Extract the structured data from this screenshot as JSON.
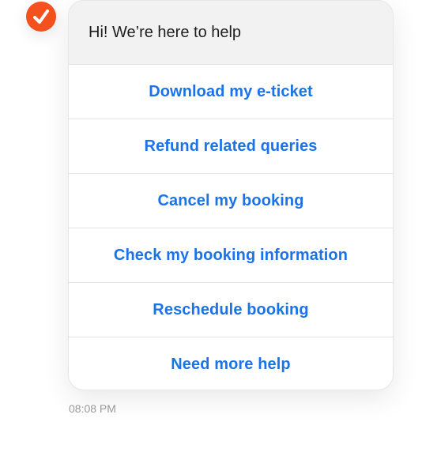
{
  "brand": {
    "icon": "checkmark-icon",
    "accent_color": "#f4511e",
    "link_color": "#1a73e8"
  },
  "chat": {
    "greeting": "Hi! We’re here to help",
    "options": [
      {
        "label": "Download my e-ticket"
      },
      {
        "label": "Refund related queries"
      },
      {
        "label": "Cancel my booking"
      },
      {
        "label": "Check my booking information"
      },
      {
        "label": "Reschedule booking"
      },
      {
        "label": "Need more help"
      }
    ],
    "timestamp": "08:08 PM"
  }
}
